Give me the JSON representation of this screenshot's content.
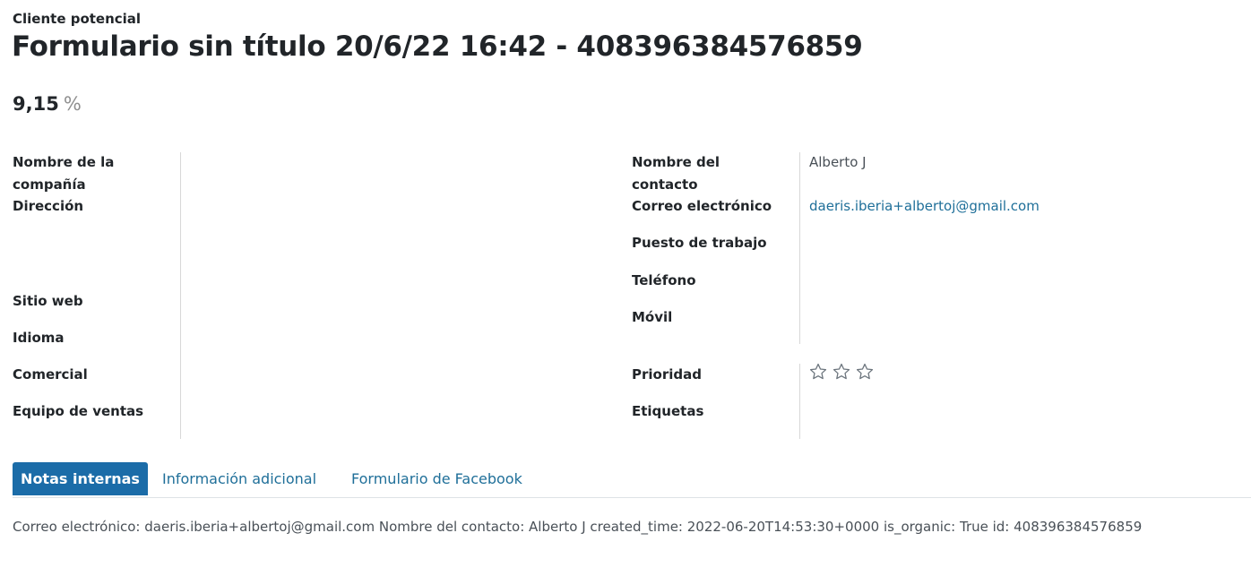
{
  "header": {
    "record_type": "Cliente potencial",
    "title": "Formulario sin título 20/6/22 16:42 - 408396384576859",
    "probability_value": "9,15",
    "probability_unit": "%"
  },
  "left_fields": {
    "company_name_label": "Nombre de la compañía",
    "address_label": "Dirección",
    "website_label": "Sitio web",
    "language_label": "Idioma",
    "salesperson_label": "Comercial",
    "sales_team_label": "Equipo de ventas"
  },
  "right_fields": {
    "contact_name_label": "Nombre del contacto",
    "contact_name_value": "Alberto J",
    "email_label": "Correo electrónico",
    "email_value": "daeris.iberia+albertoj@gmail.com",
    "job_position_label": "Puesto de trabajo",
    "phone_label": "Teléfono",
    "mobile_label": "Móvil",
    "priority_label": "Prioridad",
    "priority_stars_filled": 0,
    "priority_stars_total": 3,
    "tags_label": "Etiquetas"
  },
  "tabs": [
    {
      "label": "Notas internas",
      "active": true
    },
    {
      "label": "Información adicional",
      "active": false
    },
    {
      "label": "Formulario de Facebook",
      "active": false
    }
  ],
  "notes": {
    "text": "Correo electrónico: daeris.iberia+albertoj@gmail.com Nombre del contacto: Alberto J created_time: 2022-06-20T14:53:30+0000 is_organic: True id: 408396384576859"
  },
  "colors": {
    "accent": "#1b6ca8",
    "link": "#1f6f99",
    "text": "#212529",
    "muted": "#495057",
    "separator": "#d8d8d8"
  }
}
